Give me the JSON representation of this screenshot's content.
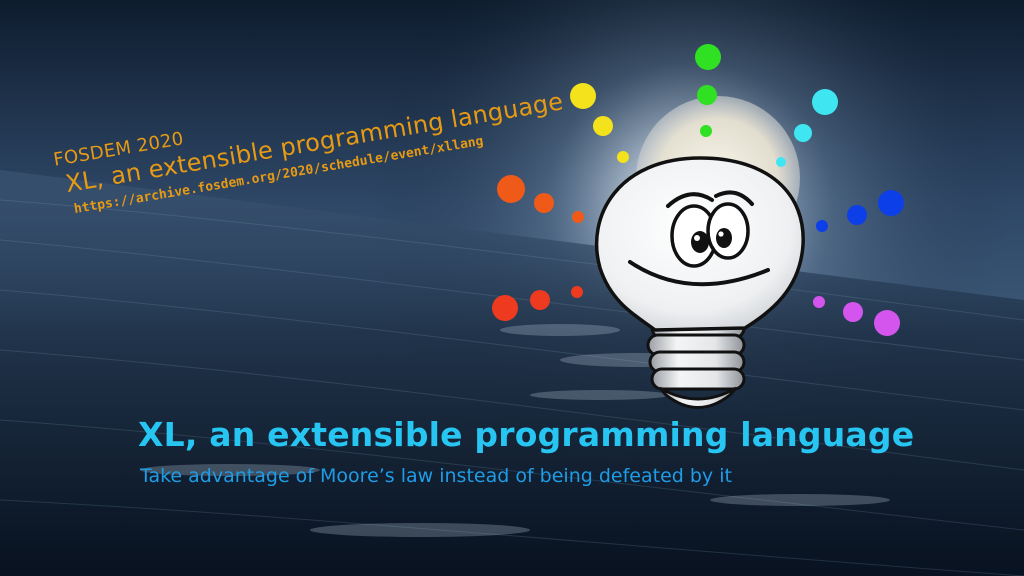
{
  "header": {
    "event": "FOSDEM 2020",
    "talk_title": "XL, an extensible programming language",
    "url": "https://archive.fosdem.org/2020/schedule/event/xllang"
  },
  "main": {
    "title": "XL, an extensible programming language",
    "tagline": "Take advantage of Moore’s law instead of being defeated by it"
  },
  "mascot": {
    "name": "lightbulb-mascot",
    "dot_colors": {
      "green": "#2fe023",
      "cyan": "#3fe6f2",
      "yellow": "#f3e21c",
      "orange": "#f05a19",
      "red": "#ee3a1e",
      "blue": "#0d3fe8",
      "magenta": "#d455ee"
    }
  },
  "colors": {
    "accent_orange": "#e79a13",
    "title_cyan": "#27c6f2",
    "tagline_blue": "#1f9ce6"
  }
}
